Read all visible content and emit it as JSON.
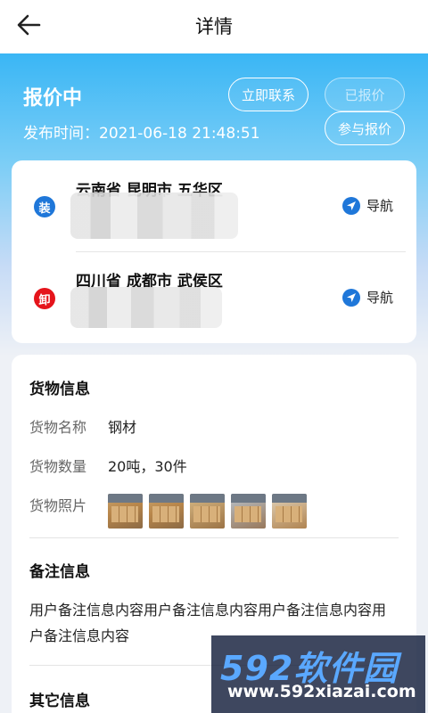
{
  "header": {
    "back_icon": "arrow-left-icon",
    "title": "详情"
  },
  "order": {
    "status": "报价中",
    "publish_time_label": "发布时间：2021-06-18 21:48:51",
    "actions": {
      "contact": "立即联系",
      "quoted": "已报价",
      "join": "参与报价"
    }
  },
  "route": {
    "load": {
      "badge": "装",
      "address": "云南省 昆明市 五华区",
      "nav_label": "导航"
    },
    "unload": {
      "badge": "卸",
      "address": "四川省 成都市 武侯区",
      "nav_label": "导航"
    }
  },
  "cargo": {
    "section_title": "货物信息",
    "name_label": "货物名称",
    "name_value": "钢材",
    "quantity_label": "货物数量",
    "quantity_value": "20吨，30件",
    "photos_label": "货物照片",
    "photo_count": 5
  },
  "remark": {
    "section_title": "备注信息",
    "text": "用户备注信息内容用户备注信息内容用户备注信息内容用户备注信息内容"
  },
  "other": {
    "section_title": "其它信息"
  },
  "watermark": {
    "brand": "592软件园",
    "url": "www.592xiazai.com"
  },
  "colors": {
    "accent": "#1f77d9",
    "unload": "#e5141b",
    "hero_top": "#3ab6f5"
  }
}
